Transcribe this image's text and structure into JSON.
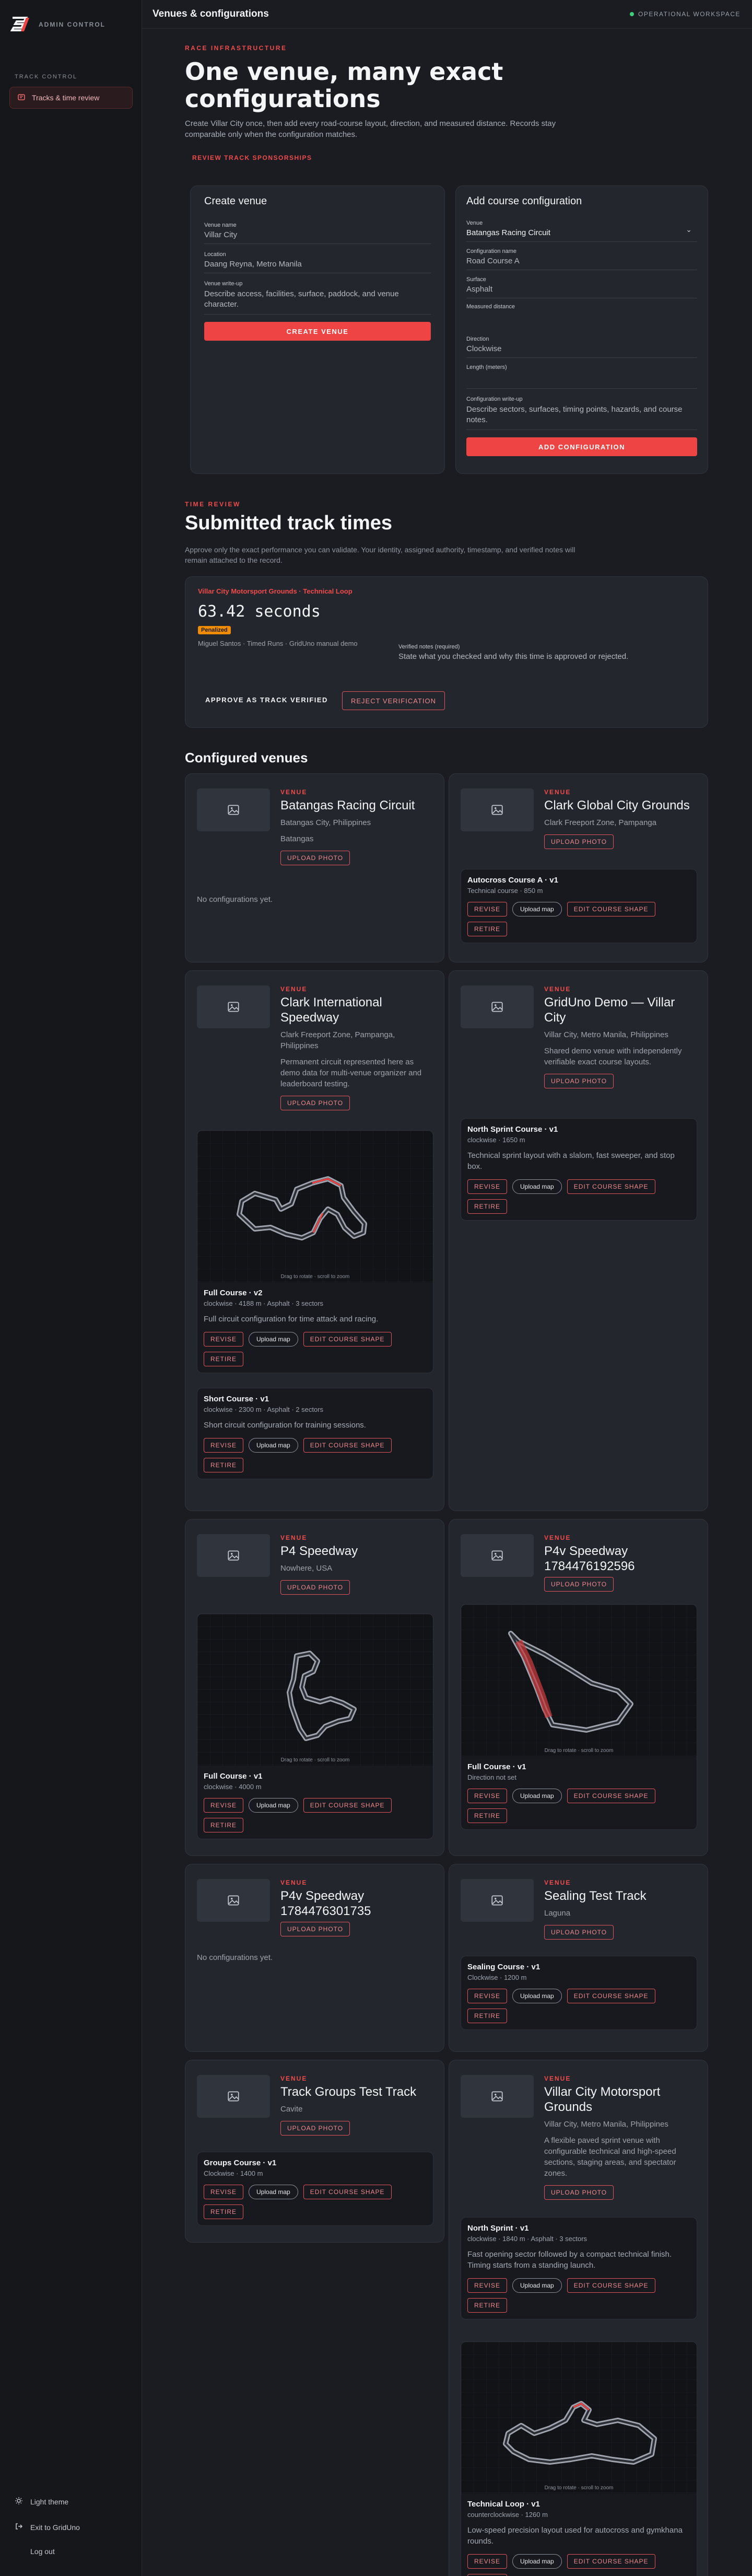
{
  "sidebar": {
    "brand_title": "ADMIN CONTROL",
    "section_label": "TRACK CONTROL",
    "nav_item": "Tracks & time review",
    "bottom": {
      "theme": "Light theme",
      "exit": "Exit to GridUno",
      "logout": "Log out"
    }
  },
  "topbar": {
    "title": "Venues & configurations",
    "status": "OPERATIONAL WORKSPACE"
  },
  "hero": {
    "eyebrow": "RACE INFRASTRUCTURE",
    "title": "One venue, many exact configurations",
    "desc": "Create Villar City once, then add every road-course layout, direction, and measured distance. Records stay comparable only when the configuration matches.",
    "link": "REVIEW TRACK SPONSORSHIPS"
  },
  "create_venue": {
    "heading": "Create venue",
    "name_label": "Venue name",
    "name_value": "Villar City",
    "location_label": "Location",
    "location_value": "Daang Reyna, Metro Manila",
    "writeup_label": "Venue write-up",
    "writeup_value": "Describe access, facilities, surface, paddock, and venue character.",
    "submit": "CREATE VENUE"
  },
  "add_config": {
    "heading": "Add course configuration",
    "venue_label": "Venue",
    "venue_value": "Batangas Racing Circuit",
    "cfg_label": "Configuration name",
    "cfg_value": "Road Course A",
    "surface_label": "Surface",
    "surface_value": "Asphalt",
    "distance_label": "Measured distance",
    "direction_label": "Direction",
    "direction_value": "Clockwise",
    "length_label": "Length (meters)",
    "writeup_label": "Configuration write-up",
    "writeup_value": "Describe sectors, surfaces, timing points, hazards, and course notes.",
    "submit": "ADD CONFIGURATION"
  },
  "time_review": {
    "eyebrow": "TIME REVIEW",
    "title": "Submitted track times",
    "desc": "Approve only the exact performance you can validate. Your identity, assigned authority, timestamp, and verified notes will remain attached to the record.",
    "card": {
      "venue": "Villar City Motorsport Grounds · Technical Loop",
      "time": "63.42 seconds",
      "badge": "Penalized",
      "meta": "Miguel Santos · Timed Runs · GridUno manual demo",
      "notes_label": "Verified notes (required)",
      "notes_placeholder": "State what you checked and why this time is approved or rejected.",
      "approve": "APPROVE AS TRACK VERIFIED",
      "reject": "REJECT VERIFICATION"
    }
  },
  "configured": {
    "title": "Configured venues"
  },
  "labels": {
    "venue": "VENUE",
    "upload_photo": "UPLOAD PHOTO",
    "revise": "REVISE",
    "upload_map": "Upload map",
    "edit_shape": "EDIT COURSE SHAPE",
    "retire": "RETIRE",
    "no_configs": "No configurations yet.",
    "map_hint": "Drag to rotate · scroll to zoom"
  },
  "venues": [
    {
      "name": "Batangas Racing Circuit",
      "location": "Batangas City, Philippines",
      "desc": "Batangas"
    },
    {
      "name": "Clark Global City Grounds",
      "location": "Clark Freeport Zone, Pampanga",
      "configs": [
        {
          "name": "Autocross Course A · v1",
          "meta": "Technical course · 850 m"
        }
      ]
    },
    {
      "name": "Clark International Speedway",
      "location": "Clark Freeport Zone, Pampanga, Philippines",
      "desc": "Permanent circuit represented here as demo data for multi-venue organizer and leaderboard testing.",
      "configs": [
        {
          "name": "Full Course · v2",
          "meta": "clockwise · 4188 m · Asphalt · 3 sectors",
          "desc": "Full circuit configuration for time attack and racing."
        },
        {
          "name": "Short Course · v1",
          "meta": "clockwise · 2300 m · Asphalt · 2 sectors",
          "desc": "Short circuit configuration for training sessions."
        }
      ]
    },
    {
      "name": "GridUno Demo — Villar City",
      "location": "Villar City, Metro Manila, Philippines",
      "desc": "Shared demo venue with independently verifiable exact course layouts.",
      "configs": [
        {
          "name": "North Sprint Course · v1",
          "meta": "clockwise · 1650 m",
          "desc": "Technical sprint layout with a slalom, fast sweeper, and stop box."
        }
      ]
    },
    {
      "name": "P4 Speedway",
      "location": "Nowhere, USA",
      "configs": [
        {
          "name": "Full Course · v1",
          "meta": "clockwise · 4000 m"
        }
      ]
    },
    {
      "name": "P4v Speedway 1784476192596",
      "configs": [
        {
          "name": "Full Course · v1",
          "meta": "Direction not set"
        }
      ]
    },
    {
      "name": "P4v Speedway 1784476301735"
    },
    {
      "name": "Sealing Test Track",
      "location": "Laguna",
      "configs": [
        {
          "name": "Sealing Course · v1",
          "meta": "Clockwise · 1200 m"
        }
      ]
    },
    {
      "name": "Track Groups Test Track",
      "location": "Cavite",
      "configs": [
        {
          "name": "Groups Course · v1",
          "meta": "Clockwise · 1400 m"
        }
      ]
    },
    {
      "name": "Villar City Motorsport Grounds",
      "location": "Villar City, Metro Manila, Philippines",
      "desc": "A flexible paved sprint venue with configurable technical and high-speed sections, staging areas, and spectator zones.",
      "configs": [
        {
          "name": "North Sprint · v1",
          "meta": "clockwise · 1840 m · Asphalt · 3 sectors",
          "desc": "Fast opening sector followed by a compact technical finish. Timing starts from a standing launch."
        },
        {
          "name": "Technical Loop · v1",
          "meta": "counterclockwise · 1260 m",
          "desc": "Low-speed precision layout used for autocross and gymkhana rounds."
        }
      ]
    }
  ],
  "colors": {
    "accent": "#ef4444",
    "bg": "#1a1c22",
    "card": "#23262d",
    "status_ok": "#3ccf7a",
    "badge": "#f08c00"
  }
}
